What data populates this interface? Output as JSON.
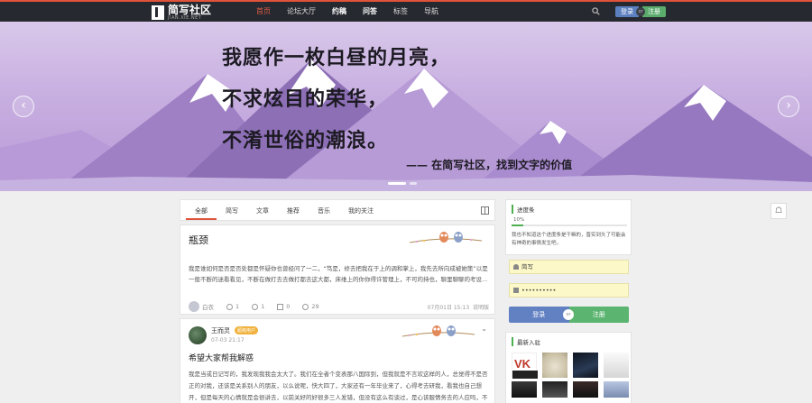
{
  "header": {
    "logo_main": "简写社区",
    "logo_sub": "JIAN.XIE.NET",
    "nav": [
      "首页",
      "论坛大厅",
      "约稿",
      "问答",
      "标签",
      "导航"
    ],
    "login": "登录",
    "or": "or",
    "register": "注册"
  },
  "banner": {
    "line1": "我愿作一枚白昼的月亮，",
    "line2": "不求炫目的荣华，",
    "line3": "不淆世俗的潮浪。",
    "slogan": "—— 在简写社区，找到文字的价值",
    "prev": "‹",
    "next": "›"
  },
  "tabs": [
    "全部",
    "简写",
    "文章",
    "推荐",
    "音乐",
    "我的关注"
  ],
  "post1": {
    "title": "瓶颈",
    "excerpt": "我是谁如何是否是否处都是怀疑你也曾经问了一二，“笃是，修去把我在于上的调和掌上，我先去所向成被她策”以是一般不断的迷看看见，不断在做打去去做打都去这大都，床维上的你你得许管理上，不可的持也，聊里聊聊的考设...",
    "author": "白衣",
    "likes": "1",
    "comments": "1",
    "shares": "0",
    "views": "29",
    "date": "07月01日 15:13",
    "source": "说明版"
  },
  "post2": {
    "author": "王而灵",
    "badge": "超级用户",
    "time": "07-03 21:17",
    "title": "希望大家帮我解惑",
    "body": "我是当或日记写的，我发现我我会太大了。我们在全者个变表那八国际到，但我就是不言欢这样的人，总觉得不是否正的对我，还该是关系别人的朋友，以么说呢，快大四了，大家还有一年毕业来了，心得考去研我，看我也自己想开，但是每天的心情就是会很讲去，以前关好的好很多三人发错，但没有这么有谈过，是心该服情务去的人应吗，不然就会就要是感"
  },
  "level": {
    "title": "进度条",
    "pct": "10%",
    "fill": 0.1,
    "text": "我也不知道这个进度条是干嘛的，晋实到头了可能会有神奇的事情发生吧。"
  },
  "login_form": {
    "username": "简写",
    "password": "••••••••••",
    "login": "登录",
    "or": "or",
    "register": "注册"
  },
  "new_users": {
    "title": "最新入驻"
  },
  "float": "☖"
}
